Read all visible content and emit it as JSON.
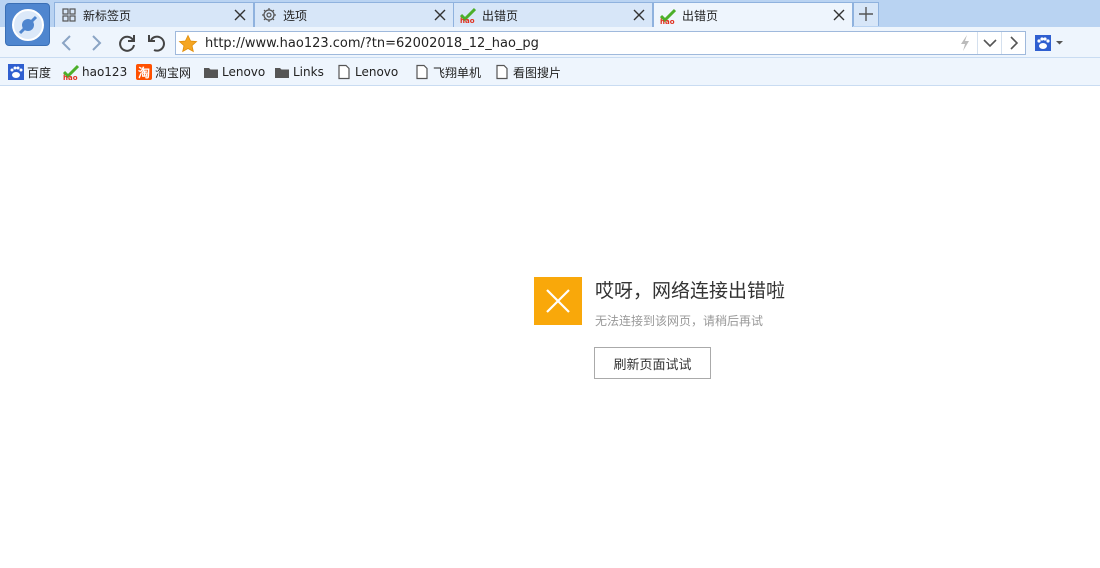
{
  "browser": {
    "logo_icon": "browser-logo-icon",
    "new_tab_icon": "plus-icon"
  },
  "tabs": [
    {
      "title": "新标签页",
      "icon": "grid-icon",
      "active": false
    },
    {
      "title": "选项",
      "icon": "gear-icon",
      "active": false
    },
    {
      "title": "出错页",
      "icon": "hao123-icon",
      "active": false
    },
    {
      "title": "出错页",
      "icon": "hao123-icon",
      "active": true
    }
  ],
  "nav": {
    "back_icon": "chevron-left-icon",
    "forward_icon": "chevron-right-icon",
    "refresh_icon": "refresh-icon",
    "undo_icon": "undo-icon",
    "url": "http://www.hao123.com/?tn=62002018_12_hao_pg",
    "favorite_icon": "star-icon",
    "accelerate_icon": "lightning-icon",
    "dropdown_icon": "chevron-down-icon",
    "go_icon": "chevron-right-icon",
    "search_engine_icon": "baidu-paw-icon"
  },
  "bookmarks": [
    {
      "label": "百度",
      "icon": "baidu-paw-icon"
    },
    {
      "label": "hao123",
      "icon": "hao123-icon"
    },
    {
      "label": "淘宝网",
      "icon": "taobao-icon"
    },
    {
      "label": "Lenovo",
      "icon": "folder-icon"
    },
    {
      "label": "Links",
      "icon": "folder-icon"
    },
    {
      "label": "Lenovo",
      "icon": "page-icon"
    },
    {
      "label": "飞翔单机",
      "icon": "page-icon"
    },
    {
      "label": "看图搜片",
      "icon": "page-icon"
    }
  ],
  "error": {
    "icon": "close-icon",
    "title": "哎呀，网络连接出错啦",
    "subtitle": "无法连接到该网页，请稍后再试",
    "reload_label": "刷新页面试试"
  },
  "colors": {
    "tab_strip": "#b9d3f2",
    "toolbar": "#eef5fd",
    "error_accent": "#f9a80a",
    "star": "#f5a623"
  }
}
